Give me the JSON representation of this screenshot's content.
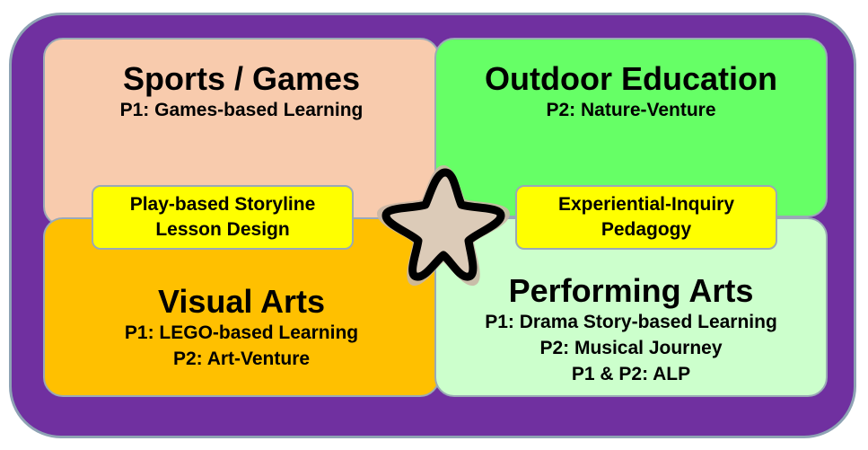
{
  "quadrants": {
    "sports": {
      "title": "Sports / Games",
      "lines": [
        "P1: Games-based Learning"
      ],
      "color": "#f8cbad"
    },
    "outdoor": {
      "title": "Outdoor Education",
      "lines": [
        "P2: Nature-Venture"
      ],
      "color": "#66ff66"
    },
    "visual": {
      "title": "Visual Arts",
      "lines": [
        "P1: LEGO-based Learning",
        "P2: Art-Venture"
      ],
      "color": "#ffc000"
    },
    "performing": {
      "title": "Performing Arts",
      "lines": [
        "P1: Drama Story-based Learning",
        "P2: Musical Journey",
        "P1 & P2: ALP"
      ],
      "color": "#ccffcc"
    }
  },
  "callouts": {
    "left": {
      "lines": [
        "Play-based Storyline",
        "Lesson Design"
      ]
    },
    "right": {
      "lines": [
        "Experiential-Inquiry",
        "Pedagogy"
      ]
    }
  },
  "center": {
    "icon": "star-icon"
  },
  "colors": {
    "frame": "#7030a0",
    "border": "#8ea3b4",
    "callout": "#ffff00",
    "star_fill": "#dccbb8",
    "star_halo": "#c9b7a5"
  }
}
